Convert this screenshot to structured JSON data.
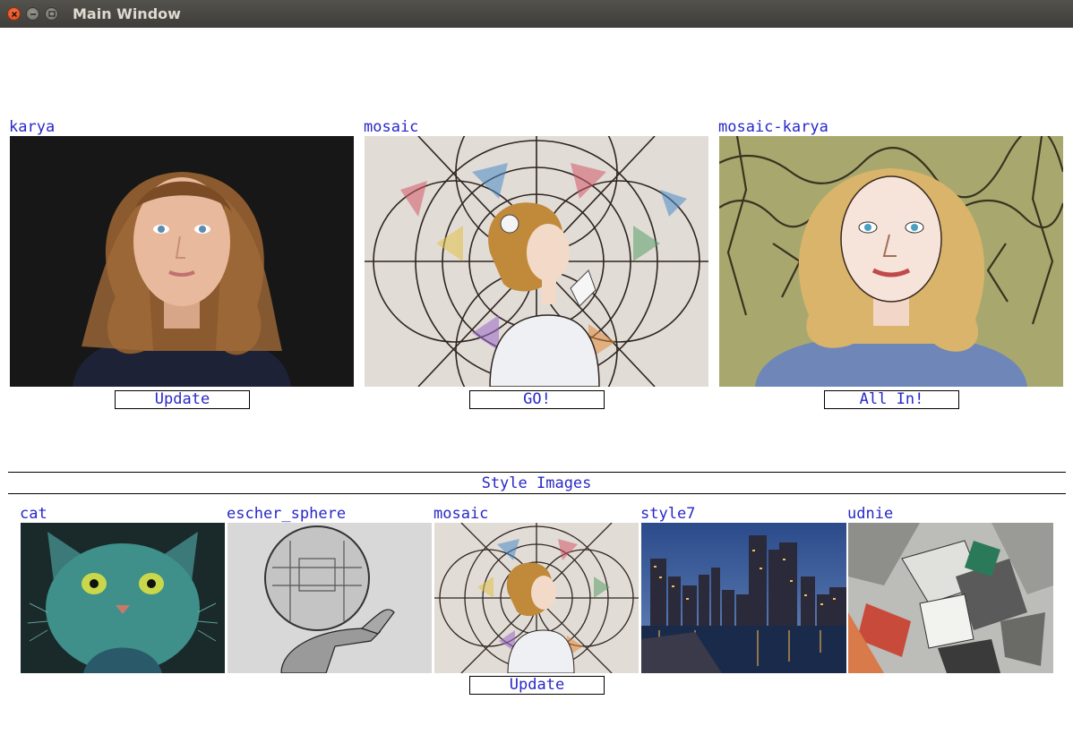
{
  "window": {
    "title": "Main Window"
  },
  "top_panels": [
    {
      "label": "karya",
      "image": "portrait-photo-woman",
      "button": "Update"
    },
    {
      "label": "mosaic",
      "image": "stained-glass-mosaic",
      "button": "GO!"
    },
    {
      "label": "mosaic-karya",
      "image": "stylized-portrait-mosaic",
      "button": "All In!"
    }
  ],
  "style_section": {
    "title": "Style Images",
    "items": [
      {
        "label": "cat",
        "image": "cat-painting"
      },
      {
        "label": "escher_sphere",
        "image": "escher-hand-sphere"
      },
      {
        "label": "mosaic",
        "image": "stained-glass-mosaic"
      },
      {
        "label": "style7",
        "image": "city-skyline-night"
      },
      {
        "label": "udnie",
        "image": "cubist-abstract"
      }
    ],
    "button": "Update"
  },
  "colors": {
    "label_text": "#2828c8",
    "titlebar": "#3e3d39",
    "close_button": "#e05a2a"
  }
}
